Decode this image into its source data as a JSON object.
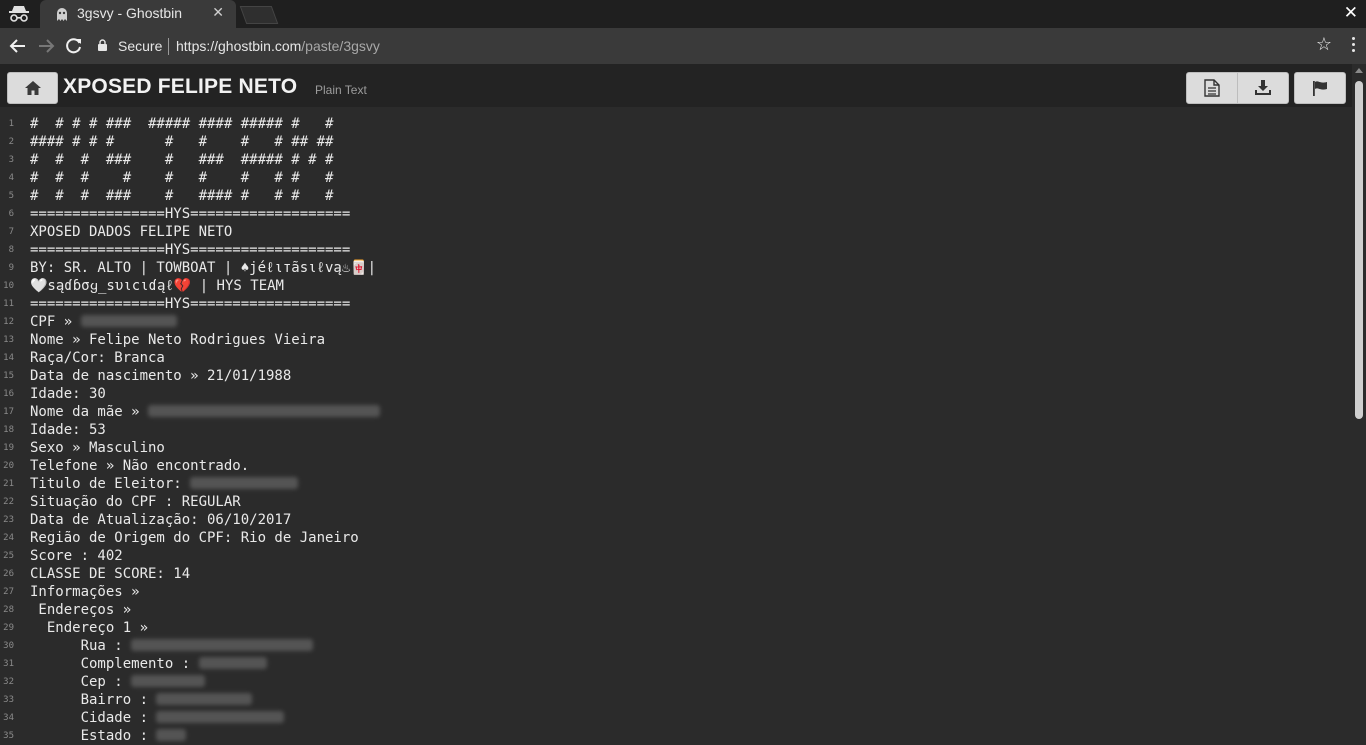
{
  "browser": {
    "tab_title": "3gsvy - Ghostbin",
    "tab_close": "✕",
    "window_close": "✕",
    "secure_label": "Secure",
    "url_host": "https://ghostbin.com",
    "url_path": "/paste/3gsvy"
  },
  "page": {
    "title": "XPOSED FELIPE NETO",
    "subtitle": "Plain Text"
  },
  "lines": [
    {
      "n": "1",
      "t": "#  # # # ###  ##### #### ##### #   #"
    },
    {
      "n": "2",
      "t": "#### # # #      #   #    #   # ## ##"
    },
    {
      "n": "3",
      "t": "#  #  #  ###    #   ###  ##### # # #"
    },
    {
      "n": "4",
      "t": "#  #  #    #    #   #    #   # #   #"
    },
    {
      "n": "5",
      "t": "#  #  #  ###    #   #### #   # #   #"
    },
    {
      "n": "6",
      "t": "================HYS==================="
    },
    {
      "n": "7",
      "t": "XPOSED DADOS FELIPE NETO"
    },
    {
      "n": "8",
      "t": "================HYS==================="
    },
    {
      "n": "9",
      "t": "BY: SR. ALTO | TOWBOAT | ♠jéℓιтãѕιℓvą♨🀄|"
    },
    {
      "n": "10",
      "t": "🤍ѕąɗɓσყ_ѕυιcιɗąℓ💔 | HYS TEAM"
    },
    {
      "n": "11",
      "t": "================HYS==================="
    },
    {
      "n": "12",
      "t": "CPF » ",
      "r": 96
    },
    {
      "n": "13",
      "t": "Nome » Felipe Neto Rodrigues Vieira"
    },
    {
      "n": "14",
      "t": "Raça/Cor: Branca"
    },
    {
      "n": "15",
      "t": "Data de nascimento » 21/01/1988"
    },
    {
      "n": "16",
      "t": "Idade: 30"
    },
    {
      "n": "17",
      "t": "Nome da mãe » ",
      "r": 232
    },
    {
      "n": "18",
      "t": "Idade: 53"
    },
    {
      "n": "19",
      "t": "Sexo » Masculino"
    },
    {
      "n": "20",
      "t": "Telefone » Não encontrado."
    },
    {
      "n": "21",
      "t": "Titulo de Eleitor: ",
      "r": 108
    },
    {
      "n": "22",
      "t": "Situação do CPF : REGULAR"
    },
    {
      "n": "23",
      "t": "Data de Atualização: 06/10/2017"
    },
    {
      "n": "24",
      "t": "Região de Origem do CPF: Rio de Janeiro"
    },
    {
      "n": "25",
      "t": "Score : 402"
    },
    {
      "n": "26",
      "t": "CLASSE DE SCORE: 14"
    },
    {
      "n": "27",
      "t": "Informações »"
    },
    {
      "n": "28",
      "t": " Endereços »"
    },
    {
      "n": "29",
      "t": "  Endereço 1 »"
    },
    {
      "n": "30",
      "t": "      Rua : ",
      "r": 182
    },
    {
      "n": "31",
      "t": "      Complemento : ",
      "r": 68
    },
    {
      "n": "32",
      "t": "      Cep : ",
      "r": 74
    },
    {
      "n": "33",
      "t": "      Bairro : ",
      "r": 96
    },
    {
      "n": "34",
      "t": "      Cidade : ",
      "r": 128
    },
    {
      "n": "35",
      "t": "      Estado : ",
      "r": 30
    }
  ]
}
